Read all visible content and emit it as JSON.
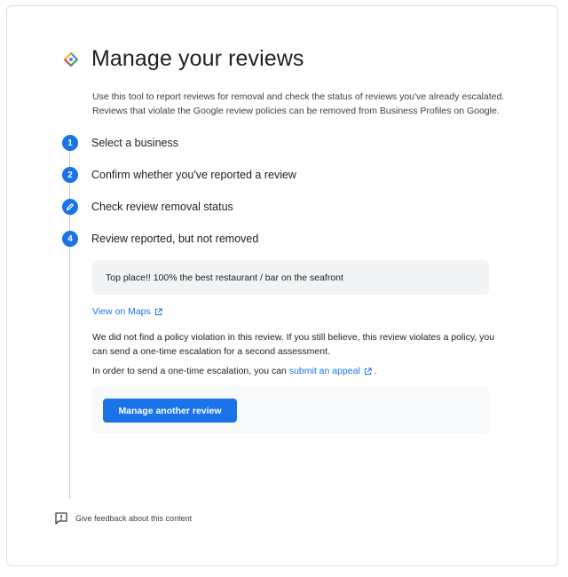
{
  "page": {
    "title": "Manage your reviews",
    "intro": "Use this tool to report reviews for removal and check the status of reviews you've already escalated. Reviews that violate the Google review policies can be removed from Business Profiles on Google."
  },
  "steps": [
    {
      "number": "1",
      "label": "Select a business"
    },
    {
      "number": "2",
      "label": "Confirm whether you've reported a review"
    },
    {
      "number": "",
      "icon": "pencil-icon",
      "label": "Check review removal status"
    },
    {
      "number": "4",
      "label": "Review reported, but not removed"
    }
  ],
  "review": {
    "text": "Top place!! 100% the best restaurant / bar on the seafront",
    "maps_link": "View on Maps"
  },
  "result": {
    "message": "We did not find a policy violation in this review. If you still believe, this review violates a policy, you can send a one-time escalation for a second assessment.",
    "appeal_prefix": "In order to send a one-time escalation, you can",
    "appeal_link": "submit an appeal",
    "appeal_suffix": "."
  },
  "actions": {
    "manage_another": "Manage another review"
  },
  "feedback": {
    "label": "Give feedback about this content"
  },
  "colors": {
    "accent": "#1a73e8",
    "rail": "#c4c7c5",
    "quote_bg": "#f1f3f4",
    "action_bg": "#f8f9fa"
  }
}
